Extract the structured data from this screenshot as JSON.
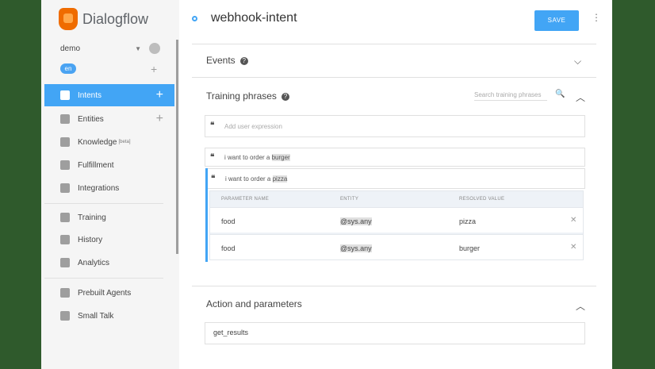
{
  "app": {
    "name": "Dialogflow"
  },
  "agent": {
    "name": "demo",
    "language": "en"
  },
  "sidebar": {
    "items": [
      {
        "label": "Intents",
        "active": true
      },
      {
        "label": "Entities"
      },
      {
        "label": "Knowledge",
        "badge": "[beta]"
      },
      {
        "label": "Fulfillment"
      },
      {
        "label": "Integrations"
      },
      {
        "label": "Training"
      },
      {
        "label": "History"
      },
      {
        "label": "Analytics"
      },
      {
        "label": "Prebuilt Agents"
      },
      {
        "label": "Small Talk"
      }
    ]
  },
  "header": {
    "title": "webhook-intent",
    "save_label": "SAVE"
  },
  "events": {
    "title": "Events"
  },
  "training": {
    "title": "Training phrases",
    "search_placeholder": "Search training phrases",
    "add_placeholder": "Add user expression",
    "phrases": [
      {
        "prefix": "i want to order a ",
        "highlight": "burger"
      },
      {
        "prefix": "i want to order a ",
        "highlight": "pizza"
      }
    ],
    "param_headers": [
      "PARAMETER NAME",
      "ENTITY",
      "RESOLVED VALUE"
    ],
    "params": [
      {
        "name": "food",
        "entity": "@sys.any",
        "value": "pizza"
      },
      {
        "name": "food",
        "entity": "@sys.any",
        "value": "burger"
      }
    ]
  },
  "action": {
    "title": "Action and parameters",
    "value": "get_results"
  },
  "colors": {
    "accent": "#42a5f5",
    "brand": "#ef6c00",
    "background": "#2f5a2c"
  }
}
